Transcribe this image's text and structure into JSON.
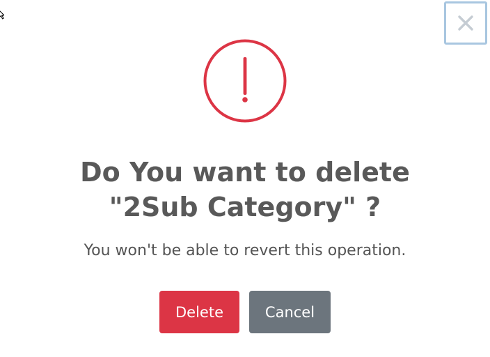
{
  "dialog": {
    "close_symbol": "×",
    "icon": "warning-exclamation-icon",
    "title_line1": "Do You want to delete",
    "title_line2": "\"2Sub Category\" ?",
    "message": "You won't be able to revert this operation.",
    "buttons": {
      "confirm_label": "Delete",
      "cancel_label": "Cancel"
    }
  },
  "colors": {
    "danger": "#dc3545",
    "secondary": "#6c757d",
    "text": "#595959"
  }
}
